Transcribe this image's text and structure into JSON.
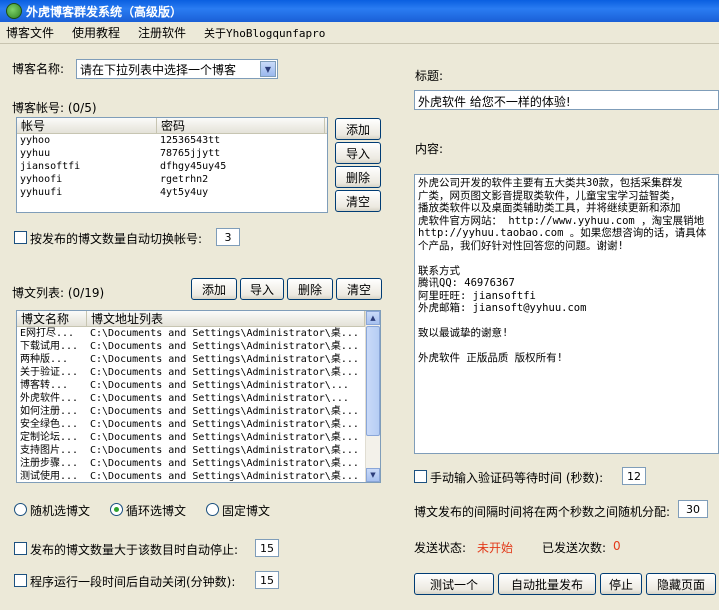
{
  "window": {
    "title": "外虎博客群发系统（高级版）"
  },
  "menu": [
    "博客文件",
    "使用教程",
    "注册软件",
    "关于YhoBlogqunfapro"
  ],
  "blog_name": {
    "label": "博客名称:",
    "selected": "请在下拉列表中选择一个博客"
  },
  "accounts": {
    "label": "博客帐号: (0/5)",
    "headers": [
      "帐号",
      "密码"
    ],
    "rows": [
      [
        "yyhoo",
        "12536543tt"
      ],
      [
        "yyhuu",
        "78765jjytt"
      ],
      [
        "jiansoftfi",
        "dfhgy45uy45"
      ],
      [
        "yyhoofi",
        "rgetrhn2"
      ],
      [
        "yyhuufi",
        "4yt5y4uy"
      ]
    ],
    "buttons": {
      "add": "添加",
      "import": "导入",
      "delete": "删除",
      "clear": "清空"
    }
  },
  "auto_switch": {
    "label": "按发布的博文数量自动切换帐号:",
    "value": "3"
  },
  "articles": {
    "label": "博文列表: (0/19)",
    "headers": [
      "博文名称",
      "博文地址列表"
    ],
    "rows": [
      [
        "E网打尽...",
        "C:\\Documents and Settings\\Administrator\\桌..."
      ],
      [
        "下载试用...",
        "C:\\Documents and Settings\\Administrator\\桌..."
      ],
      [
        "两种版...",
        "C:\\Documents and Settings\\Administrator\\桌..."
      ],
      [
        "关于验证...",
        "C:\\Documents and Settings\\Administrator\\桌..."
      ],
      [
        "博客转...",
        "C:\\Documents and Settings\\Administrator\\..."
      ],
      [
        "外虎软件...",
        "C:\\Documents and Settings\\Administrator\\..."
      ],
      [
        "如何注册...",
        "C:\\Documents and Settings\\Administrator\\桌..."
      ],
      [
        "安全绿色...",
        "C:\\Documents and Settings\\Administrator\\桌..."
      ],
      [
        "定制论坛...",
        "C:\\Documents and Settings\\Administrator\\桌..."
      ],
      [
        "支持图片...",
        "C:\\Documents and Settings\\Administrator\\桌..."
      ],
      [
        "注册步骤...",
        "C:\\Documents and Settings\\Administrator\\桌..."
      ],
      [
        "测试使用...",
        "C:\\Documents and Settings\\Administrator\\桌..."
      ]
    ],
    "buttons": {
      "add": "添加",
      "import": "导入",
      "delete": "删除",
      "clear": "清空"
    }
  },
  "mode": {
    "random": "随机选博文",
    "loop": "循环选博文",
    "fixed": "固定博文",
    "selected": "loop"
  },
  "auto_stop": {
    "label": "发布的博文数量大于该数目时自动停止:",
    "value": "15"
  },
  "auto_close": {
    "label": "程序运行一段时间后自动关闭(分钟数):",
    "value": "15"
  },
  "title_field": {
    "label": "标题:",
    "value": "外虎软件 给您不一样的体验!"
  },
  "content_field": {
    "label": "内容:",
    "lines": [
      "外虎公司开发的软件主要有五大类共30款，包括采集群发",
      "广类，网页图文影音提取类软件，儿童宝宝学习益智类，",
      "播放类软件以及桌面类辅助类工具，并将继续更新和添加",
      "虎软件官方网站： http://www.yyhuu.com ，淘宝展销地",
      "http://yyhuu.taobao.com 。如果您想咨询的话，请具体",
      "个产品，我们好针对性回答您的问题。谢谢!",
      "",
      "联系方式",
      "腾讯QQ: 46976367",
      "阿里旺旺: jiansoftfi",
      "外虎邮箱: jiansoft@yyhuu.com",
      "",
      "致以最诚挚的谢意!",
      "",
      "外虎软件 正版品质 版权所有!"
    ]
  },
  "captcha_wait": {
    "label": "手动输入验证码等待时间 (秒数):",
    "value": "12"
  },
  "interval": {
    "label": "博文发布的间隔时间将在两个秒数之间随机分配:",
    "value": "30"
  },
  "status": {
    "label": "发送状态:",
    "value": "未开始",
    "sent_label": "已发送次数:",
    "sent_value": "0"
  },
  "actions": {
    "test": "测试一个",
    "auto_publish": "自动批量发布",
    "stop": "停止",
    "hide": "隐藏页面"
  },
  "colors": {
    "title_bar": "#1a5fd6",
    "status_value": "#e23a1a",
    "window_bg": "#ece9d8"
  }
}
